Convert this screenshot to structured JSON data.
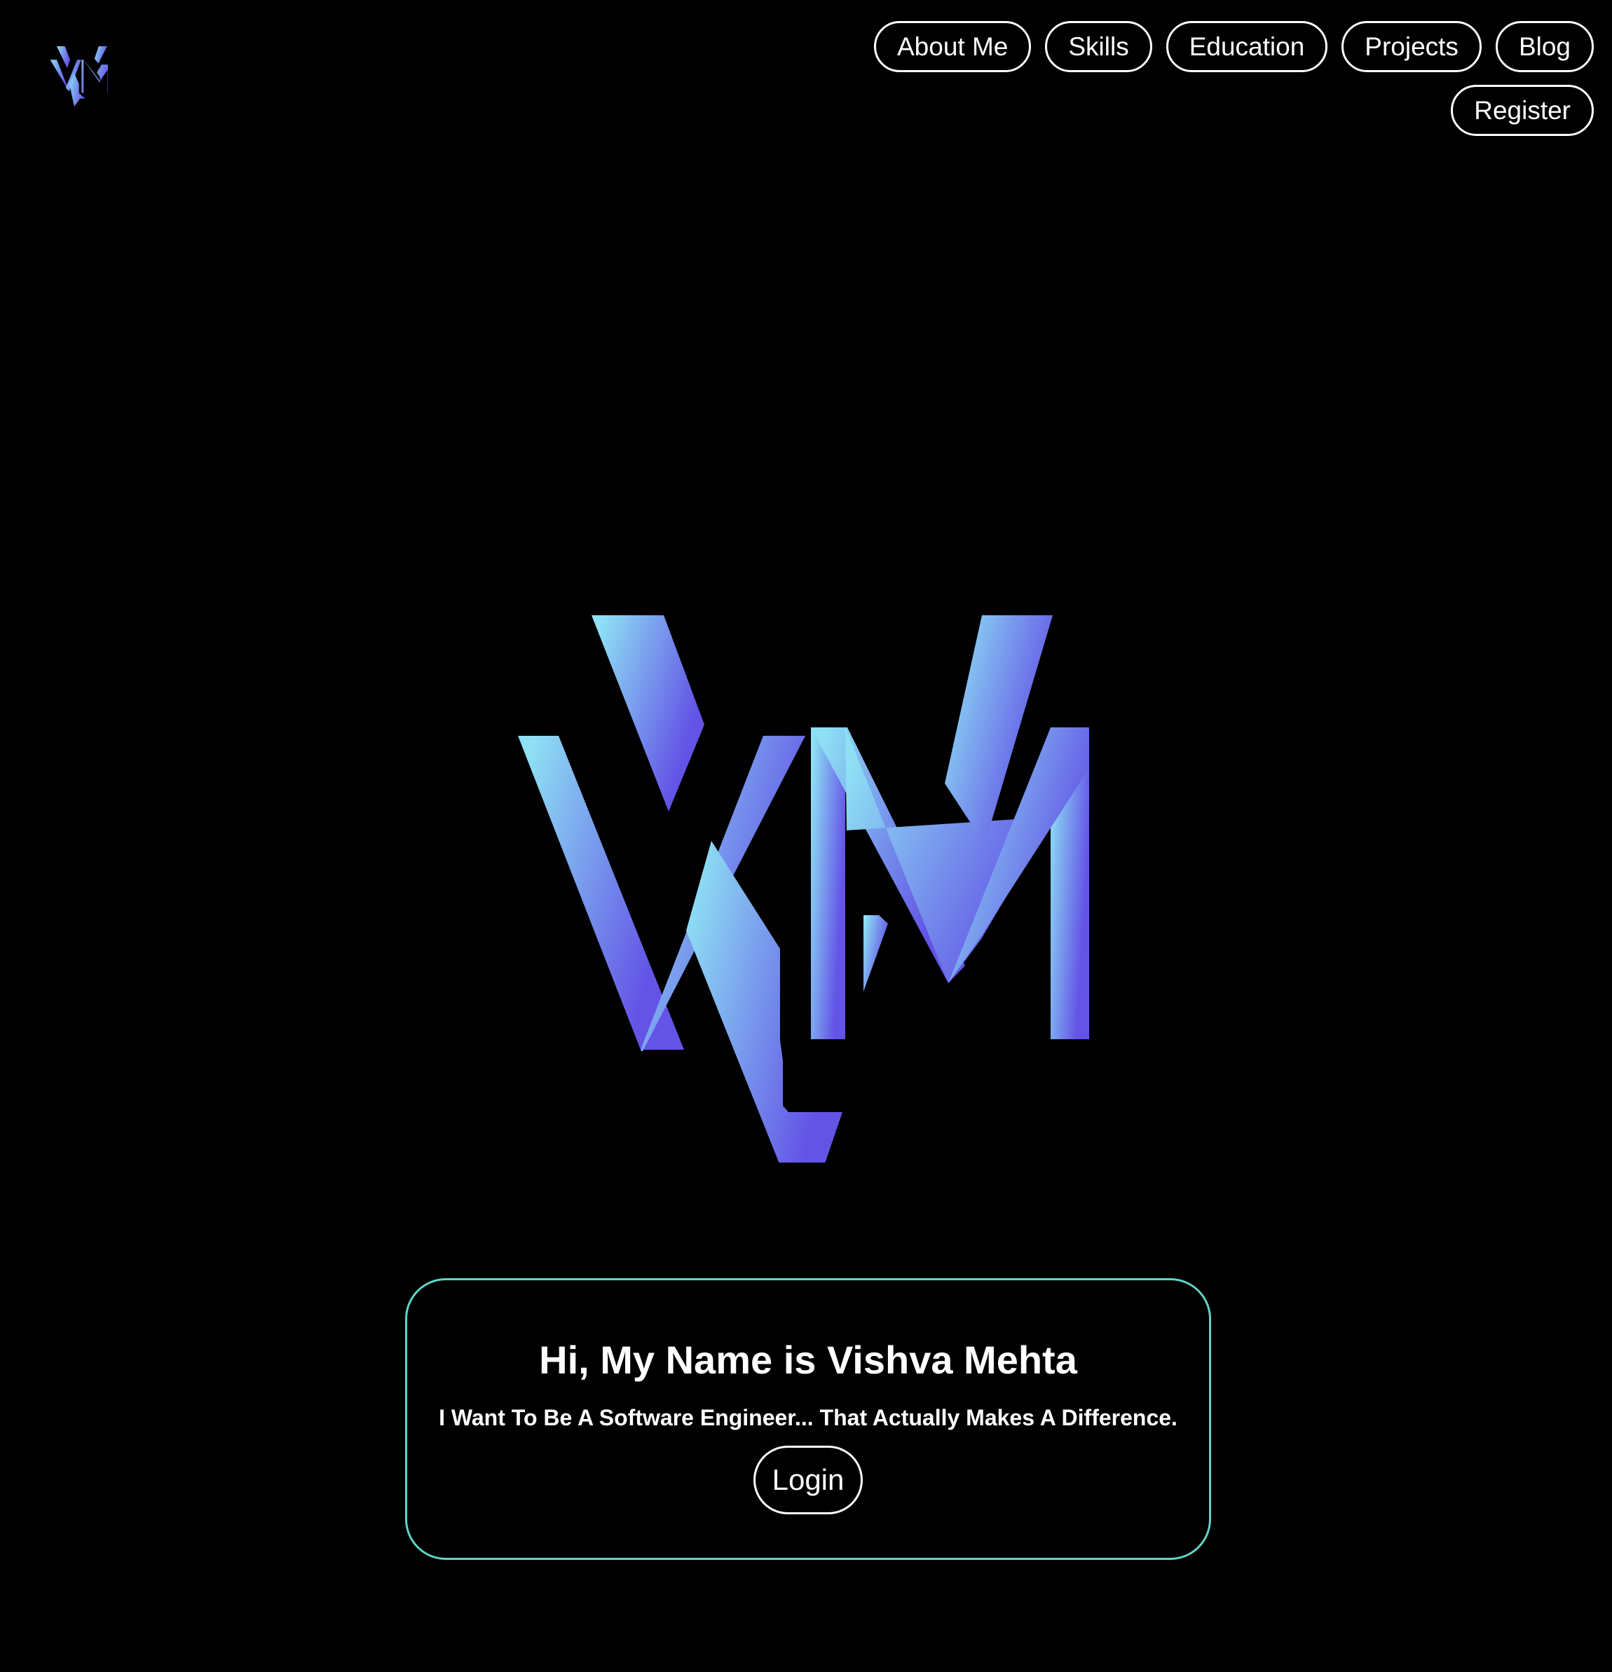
{
  "brand": {
    "logo_text": "VM",
    "gradient_start": "#8ee0f4",
    "gradient_end": "#6354e6"
  },
  "nav": {
    "items": [
      {
        "label": "About Me"
      },
      {
        "label": "Skills"
      },
      {
        "label": "Education"
      },
      {
        "label": "Projects"
      },
      {
        "label": "Blog"
      },
      {
        "label": "Register"
      }
    ]
  },
  "intro": {
    "title": "Hi, My Name is Vishva Mehta",
    "tagline": "I Want To Be A Software Engineer... That Actually Makes A Difference.",
    "login_label": "Login"
  },
  "colors": {
    "background": "#000000",
    "card_border": "#5fd4c4",
    "text": "#ffffff"
  }
}
